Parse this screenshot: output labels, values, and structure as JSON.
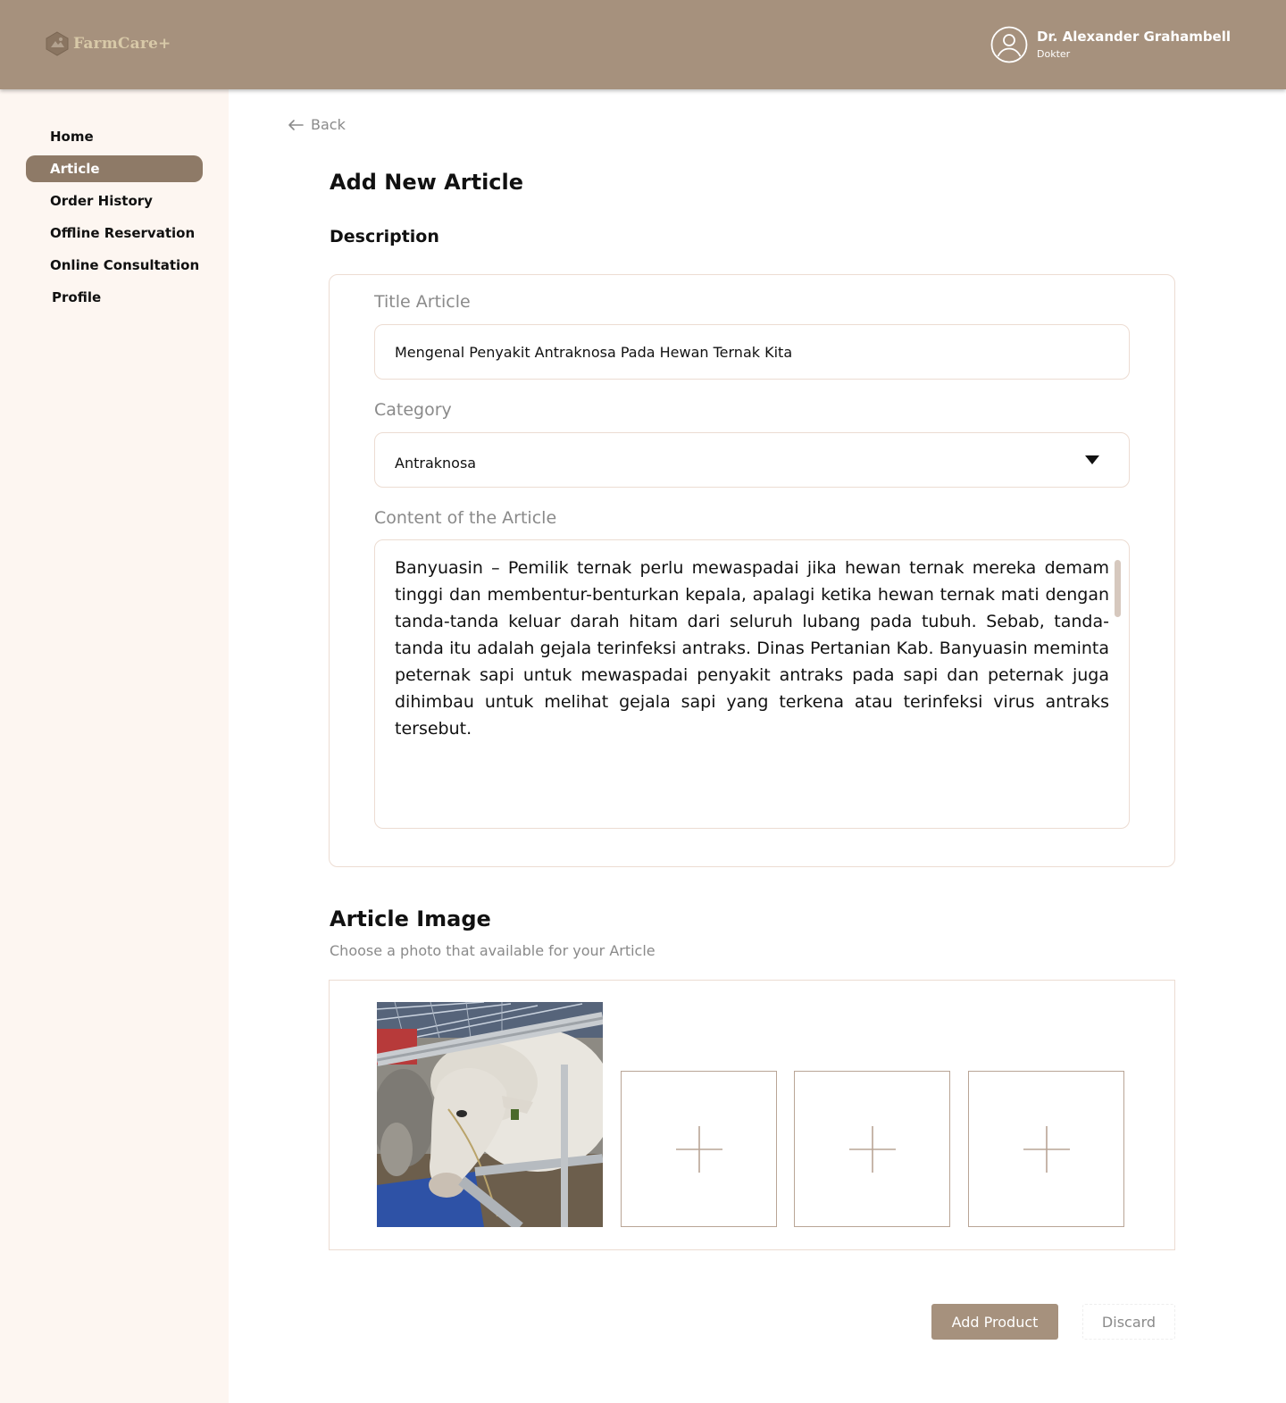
{
  "app": {
    "logo_text": "FarmCare+",
    "accent_color": "#a6917d",
    "sidebar_bg": "#fdf6f1"
  },
  "user": {
    "name": "Dr. Alexander Grahambell",
    "role": "Dokter",
    "avatar_icon": "user-circle-icon"
  },
  "sidebar": {
    "items": [
      {
        "label": "Home",
        "active": false
      },
      {
        "label": "Article",
        "active": true
      },
      {
        "label": "Order History",
        "active": false
      },
      {
        "label": "Offline Reservation",
        "active": false
      },
      {
        "label": "Online Consultation",
        "active": false
      },
      {
        "label": "Profile",
        "active": false
      }
    ]
  },
  "main": {
    "back_label": "Back",
    "page_title": "Add New Article",
    "description_title": "Description",
    "form": {
      "title_label": "Title Article",
      "title_value": "Mengenal Penyakit Antraknosa Pada Hewan Ternak Kita",
      "category_label": "Category",
      "category_value": "Antraknosa",
      "content_label": "Content of the Article",
      "content_value": "Banyuasin – Pemilik ternak perlu mewaspadai jika hewan ternak mereka demam tinggi dan membentur-benturkan kepala, apalagi ketika hewan ternak mati dengan tanda-tanda keluar darah hitam dari seluruh lubang pada tubuh. Sebab, tanda-tanda itu adalah gejala terinfeksi antraks. Dinas Pertanian Kab. Banyuasin meminta peternak sapi untuk mewaspadai penyakit antraks pada sapi dan peternak juga dihimbau untuk melihat gejala sapi yang terkena atau terinfeksi virus antraks tersebut."
    },
    "image_section": {
      "title": "Article Image",
      "subtitle": "Choose a photo that available for your Article",
      "add_slot_icon": "plus-icon",
      "empty_slots": 3
    },
    "actions": {
      "primary_label": "Add Product",
      "secondary_label": "Discard"
    }
  }
}
